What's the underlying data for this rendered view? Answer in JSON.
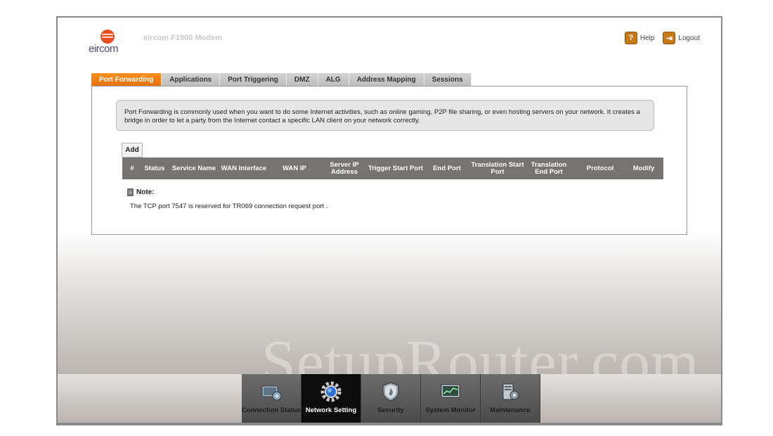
{
  "header": {
    "logo_text": "eircom",
    "modem_title": "eircom F1000 Modem",
    "help_label": "Help",
    "logout_label": "Logout"
  },
  "tabs": [
    {
      "label": "Port Forwarding",
      "active": true
    },
    {
      "label": "Applications",
      "active": false
    },
    {
      "label": "Port Triggering",
      "active": false
    },
    {
      "label": "DMZ",
      "active": false
    },
    {
      "label": "ALG",
      "active": false
    },
    {
      "label": "Address Mapping",
      "active": false
    },
    {
      "label": "Sessions",
      "active": false
    }
  ],
  "description": "Port Forwarding is commonly used when you want to do some Internet activities, such as online gaming, P2P file sharing, or even hosting servers on your network. It creates a bridge in order to let a party from the Internet contact a specific LAN client on your network correctly.",
  "add_label": "Add",
  "table": {
    "columns": [
      "#",
      "Status",
      "Service Name",
      "WAN Interface",
      "WAN IP",
      "Server IP Address",
      "Trigger Start Port",
      "End Port",
      "Translation Start Port",
      "Translation End Port",
      "Protocol",
      "Modify"
    ],
    "rows": []
  },
  "note": {
    "title": "Note:",
    "text": "The TCP port 7547 is reserved for TR069 connection request port ."
  },
  "watermark": "SetupRouter.com",
  "bottom_nav": [
    {
      "label": "Connection Status",
      "icon": "connection-status-icon",
      "active": false
    },
    {
      "label": "Network Setting",
      "icon": "network-setting-icon",
      "active": true
    },
    {
      "label": "Security",
      "icon": "security-shield-icon",
      "active": false
    },
    {
      "label": "System Monitor",
      "icon": "system-monitor-icon",
      "active": false
    },
    {
      "label": "Maintenance",
      "icon": "maintenance-icon",
      "active": false
    }
  ],
  "colors": {
    "accent_orange": "#f7901e",
    "table_header": "#767472",
    "nav_active": "#0c0c0c"
  }
}
